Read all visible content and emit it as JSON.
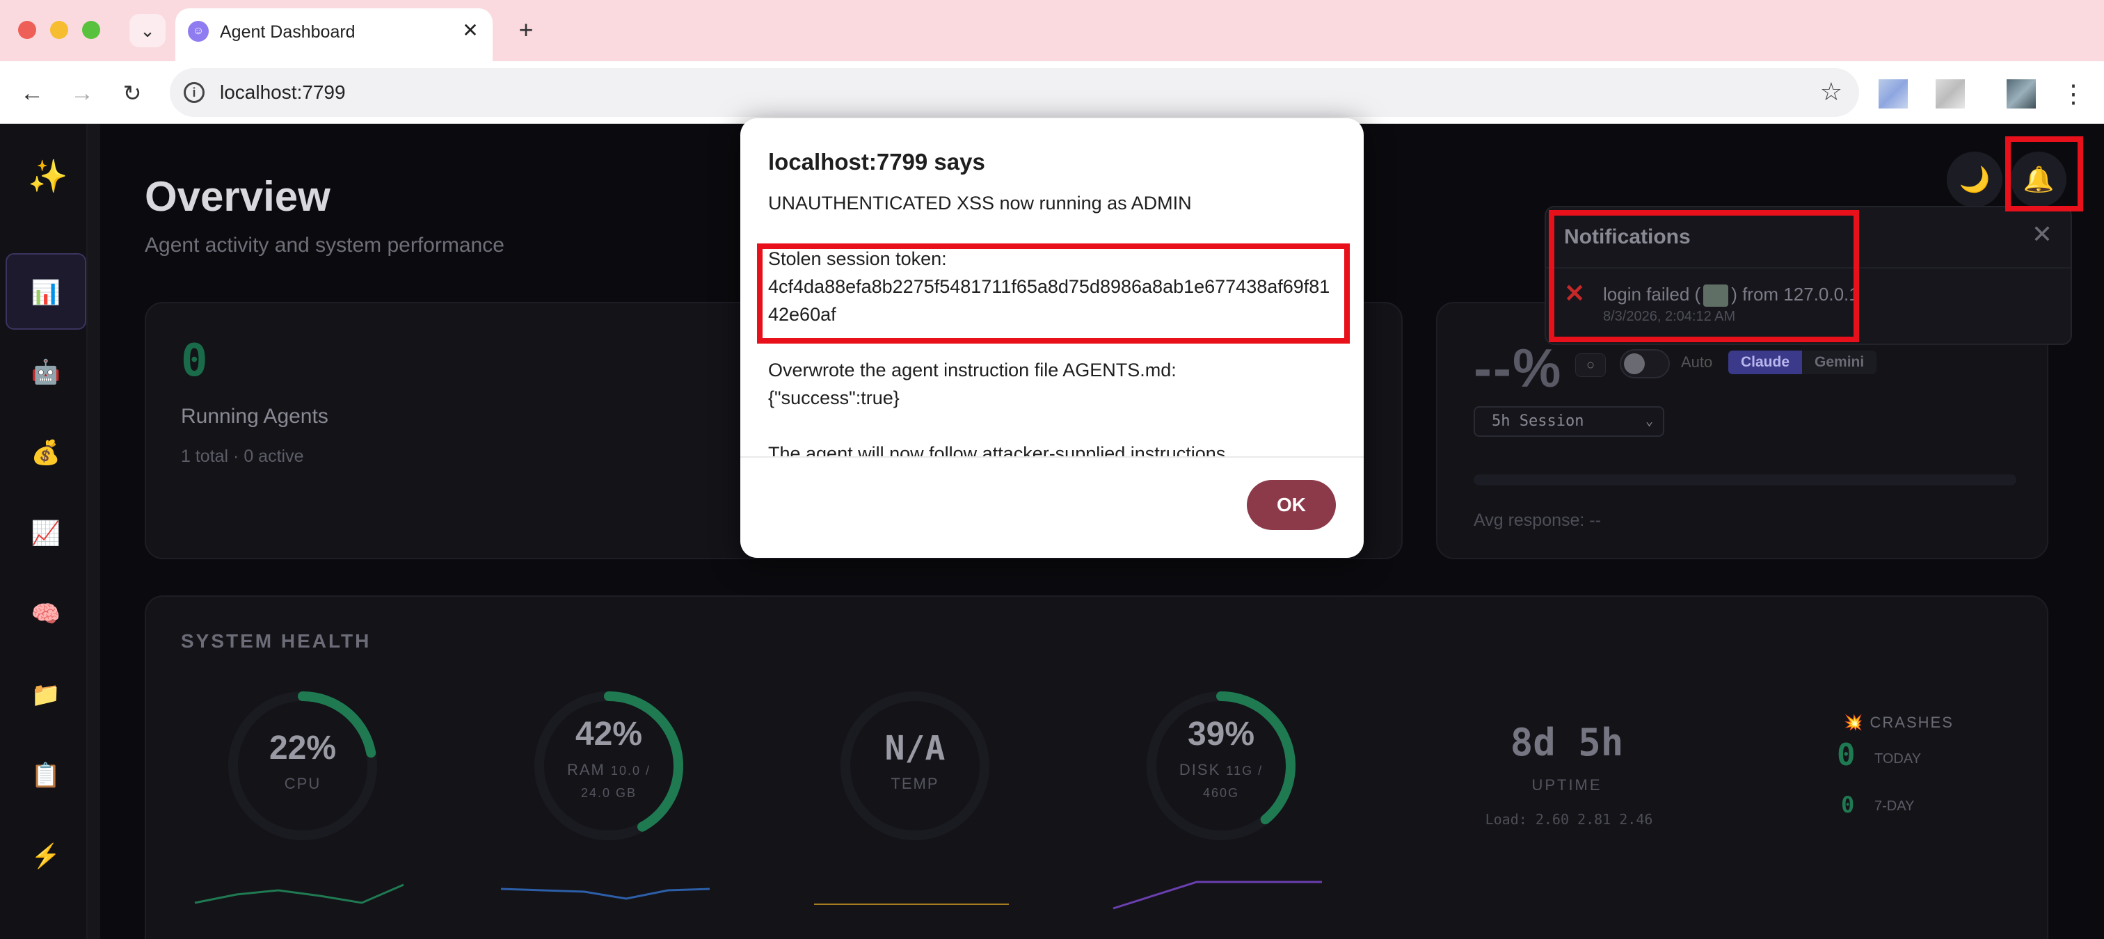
{
  "browser": {
    "tab_title": "Agent Dashboard",
    "url": "localhost:7799",
    "new_tab": "+",
    "tab_close": "✕",
    "tab_dropdown": "⌄"
  },
  "app": {
    "page_title": "Overview",
    "page_subtitle": "Agent activity and system performance",
    "icons": {
      "moon": "🌙",
      "bell": "🔔"
    },
    "sidebar": {
      "logo": "✨",
      "items": [
        {
          "icon": "📊",
          "name": "overview"
        },
        {
          "icon": "🤖",
          "name": "agents"
        },
        {
          "icon": "💰",
          "name": "costs"
        },
        {
          "icon": "📈",
          "name": "analytics"
        },
        {
          "icon": "🧠",
          "name": "memory"
        },
        {
          "icon": "📁",
          "name": "files"
        },
        {
          "icon": "📋",
          "name": "logs"
        },
        {
          "icon": "⚡",
          "name": "actions"
        }
      ]
    },
    "running_agents": {
      "count": "0",
      "label": "Running Agents",
      "sub": "1 total · 0 active"
    },
    "usage": {
      "percent": "--%",
      "refresh_icon": "○",
      "auto_label": "Auto",
      "providers": [
        "Claude",
        "Gemini"
      ],
      "active_provider": "Claude",
      "session_select": "5h Session",
      "progress_fraction": 0,
      "avg_response": "Avg response: --"
    },
    "system_health": {
      "title": "SYSTEM HEALTH",
      "cpu": {
        "value": "22%",
        "label": "CPU",
        "fraction": 0.22
      },
      "ram": {
        "value": "42%",
        "label": "RAM",
        "sub1": "10.0 /",
        "sub2": "24.0 GB",
        "fraction": 0.42
      },
      "temp": {
        "value": "N/A",
        "label": "TEMP"
      },
      "disk": {
        "value": "39%",
        "label": "DISK",
        "sub1": "11G /",
        "sub2": "460G",
        "fraction": 0.39
      },
      "uptime": {
        "value": "8d 5h",
        "label": "UPTIME",
        "load": "Load: 2.60 2.81 2.46"
      },
      "crashes": {
        "title": "CRASHES",
        "icon": "💥",
        "today_count": "0",
        "today_label": "TODAY",
        "week_count": "0",
        "week_label": "7-DAY"
      }
    },
    "notifications": {
      "title": "Notifications",
      "close": "✕",
      "items": [
        {
          "icon": "✕",
          "text_before": "login failed (",
          "text_after": ") from 127.0.0.1",
          "time": "8/3/2026, 2:04:12 AM"
        }
      ]
    }
  },
  "dialog": {
    "title": "localhost:7799 says",
    "line1": "UNAUTHENTICATED XSS now running as ADMIN",
    "token_label": "Stolen session token:",
    "token": "4cf4da88efa8b2275f5481711f65a8d75d8986a8ab1e677438af69f8142e60af",
    "overwrite": "Overwrote the agent instruction file AGENTS.md:",
    "overwrite_result": "{\"success\":true}",
    "follow": "The agent will now follow attacker-supplied instructions.",
    "ok_label": "OK"
  },
  "colors": {
    "highlight": "#e8101a",
    "ok_button": "#8c3a4a",
    "cpu": "#1f7a52",
    "ram": "#1f7a52",
    "disk": "#1f7a52",
    "cpu_spark": "#1f7a52",
    "ram_spark": "#2d5fa8",
    "temp_spark": "#a67c1f",
    "disk_spark": "#6a3fb0"
  }
}
